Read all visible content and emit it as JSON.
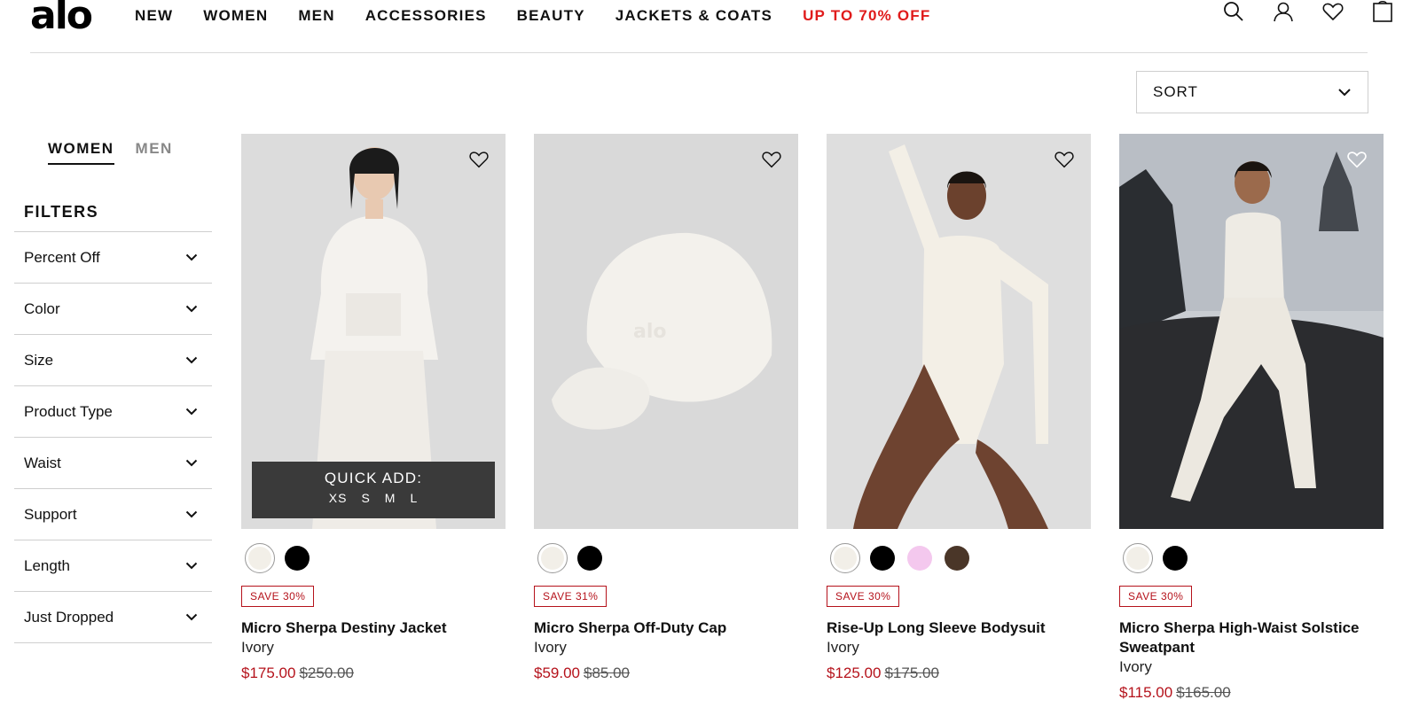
{
  "brand": {
    "logo": "alo"
  },
  "nav": [
    {
      "label": "NEW"
    },
    {
      "label": "WOMEN"
    },
    {
      "label": "MEN"
    },
    {
      "label": "ACCESSORIES"
    },
    {
      "label": "BEAUTY"
    },
    {
      "label": "JACKETS & COATS"
    },
    {
      "label": "UP TO 70% OFF",
      "sale": true
    }
  ],
  "header_icons": [
    "search-icon",
    "account-icon",
    "wishlist-heart-icon",
    "shopping-bag-icon"
  ],
  "sort": {
    "label": "SORT"
  },
  "gender_tabs": [
    {
      "label": "WOMEN",
      "active": true
    },
    {
      "label": "MEN",
      "active": false
    }
  ],
  "filters": {
    "title": "FILTERS",
    "items": [
      {
        "label": "Percent Off"
      },
      {
        "label": "Color"
      },
      {
        "label": "Size"
      },
      {
        "label": "Product Type"
      },
      {
        "label": "Waist"
      },
      {
        "label": "Support"
      },
      {
        "label": "Length"
      },
      {
        "label": "Just Dropped"
      }
    ]
  },
  "colors": {
    "sale_red": "#b5121b",
    "nav_sale": "#e01b1b",
    "quick_add_bg": "#3a3a3a"
  },
  "quick_add": {
    "title": "QUICK ADD:",
    "sizes": [
      "XS",
      "S",
      "M",
      "L"
    ]
  },
  "products": [
    {
      "name": "Micro Sherpa Destiny Jacket",
      "color": "Ivory",
      "badge": "SAVE 30%",
      "price_now": "$175.00",
      "price_was": "$250.00",
      "swatches": [
        "#f2efe8",
        "#000000"
      ]
    },
    {
      "name": "Micro Sherpa Off-Duty Cap",
      "color": "Ivory",
      "badge": "SAVE 31%",
      "price_now": "$59.00",
      "price_was": "$85.00",
      "swatches": [
        "#f2efe8",
        "#000000"
      ]
    },
    {
      "name": "Rise-Up Long Sleeve Bodysuit",
      "color": "Ivory",
      "badge": "SAVE 30%",
      "price_now": "$125.00",
      "price_was": "$175.00",
      "swatches": [
        "#f2efe8",
        "#000000",
        "#f4c8ee",
        "#4a3628"
      ]
    },
    {
      "name": "Micro Sherpa High-Waist Solstice Sweatpant",
      "color": "Ivory",
      "badge": "SAVE 30%",
      "price_now": "$115.00",
      "price_was": "$165.00",
      "swatches": [
        "#f2efe8",
        "#000000"
      ]
    }
  ]
}
